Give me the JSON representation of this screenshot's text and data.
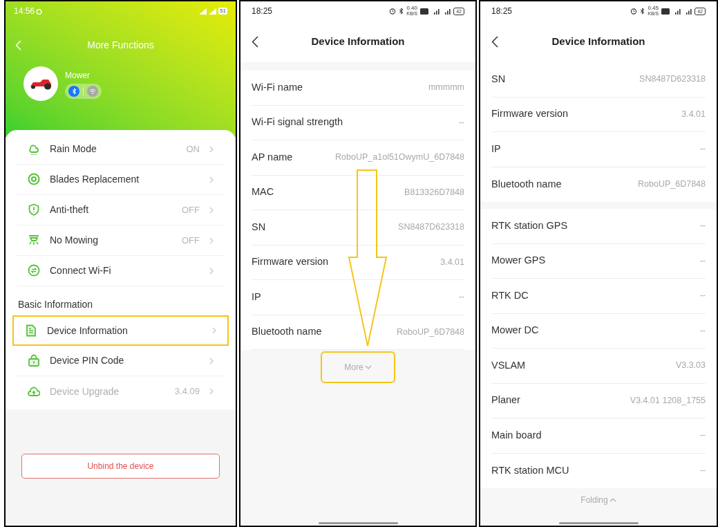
{
  "more_functions": {
    "status_bar": {
      "time": "14:56",
      "battery": "51"
    },
    "title": "More Functions",
    "device": {
      "name": "Mower",
      "bluetooth_connected": true,
      "wifi_connected": false
    },
    "items": [
      {
        "label": "Rain Mode",
        "value": "ON",
        "disabled": false,
        "highlighted": false
      },
      {
        "label": "Blades Replacement",
        "disabled": false,
        "highlighted": false
      },
      {
        "label": "Anti-theft",
        "value": "OFF",
        "disabled": false,
        "highlighted": false
      },
      {
        "label": "No Mowing",
        "value": "OFF",
        "disabled": false,
        "highlighted": false
      },
      {
        "label": "Connect Wi-Fi",
        "disabled": false,
        "highlighted": false
      }
    ],
    "section_title": "Basic Information",
    "basic_items": [
      {
        "label": "Device Information",
        "disabled": false,
        "highlighted": true
      },
      {
        "label": "Device PIN Code",
        "disabled": false,
        "highlighted": false
      },
      {
        "label": "Device Upgrade",
        "value": "3.4.09",
        "disabled": true,
        "highlighted": false
      }
    ],
    "unbind_button": "Unbind the device"
  },
  "device_info_collapsed": {
    "status_bar": {
      "time": "18:25",
      "net_speed": "0.40",
      "net_unit": "KB/S",
      "battery": "42"
    },
    "title": "Device Information",
    "rows": [
      {
        "label": "Wi-Fi name",
        "value": "mmmmm"
      },
      {
        "label": "Wi-Fi signal strength",
        "value": "--"
      },
      {
        "label": "AP name",
        "value": "RoboUP_a1ol51OwymU_6D7848"
      },
      {
        "label": "MAC",
        "value": "B813326D7848"
      },
      {
        "label": "SN",
        "value": "SN8487D623318"
      },
      {
        "label": "Firmware version",
        "value": "3.4.01"
      },
      {
        "label": "IP",
        "value": "--"
      },
      {
        "label": "Bluetooth name",
        "value": "RoboUP_6D7848"
      }
    ],
    "more_button": {
      "label": "More",
      "highlighted": true
    }
  },
  "device_info_expanded": {
    "status_bar": {
      "time": "18:25",
      "net_speed": "0.45",
      "net_unit": "KB/S",
      "battery": "42"
    },
    "title": "Device Information",
    "rows": [
      {
        "label": "SN",
        "value": "SN8487D623318"
      },
      {
        "label": "Firmware version",
        "value": "3.4.01"
      },
      {
        "label": "IP",
        "value": "--"
      },
      {
        "label": "Bluetooth name",
        "value": "RoboUP_6D7848"
      }
    ],
    "extra_rows": [
      {
        "label": "RTK station GPS",
        "value": "--"
      },
      {
        "label": "Mower GPS",
        "value": "--"
      },
      {
        "label": "RTK DC",
        "value": "--"
      },
      {
        "label": "Mower DC",
        "value": "--"
      },
      {
        "label": "VSLAM",
        "value": "V3.3.03"
      },
      {
        "label": "Planer",
        "value": "V3.4.01 1208_1755"
      },
      {
        "label": "Main board",
        "value": "--"
      },
      {
        "label": "RTK station MCU",
        "value": "--"
      }
    ],
    "folding_button": {
      "label": "Folding"
    }
  }
}
